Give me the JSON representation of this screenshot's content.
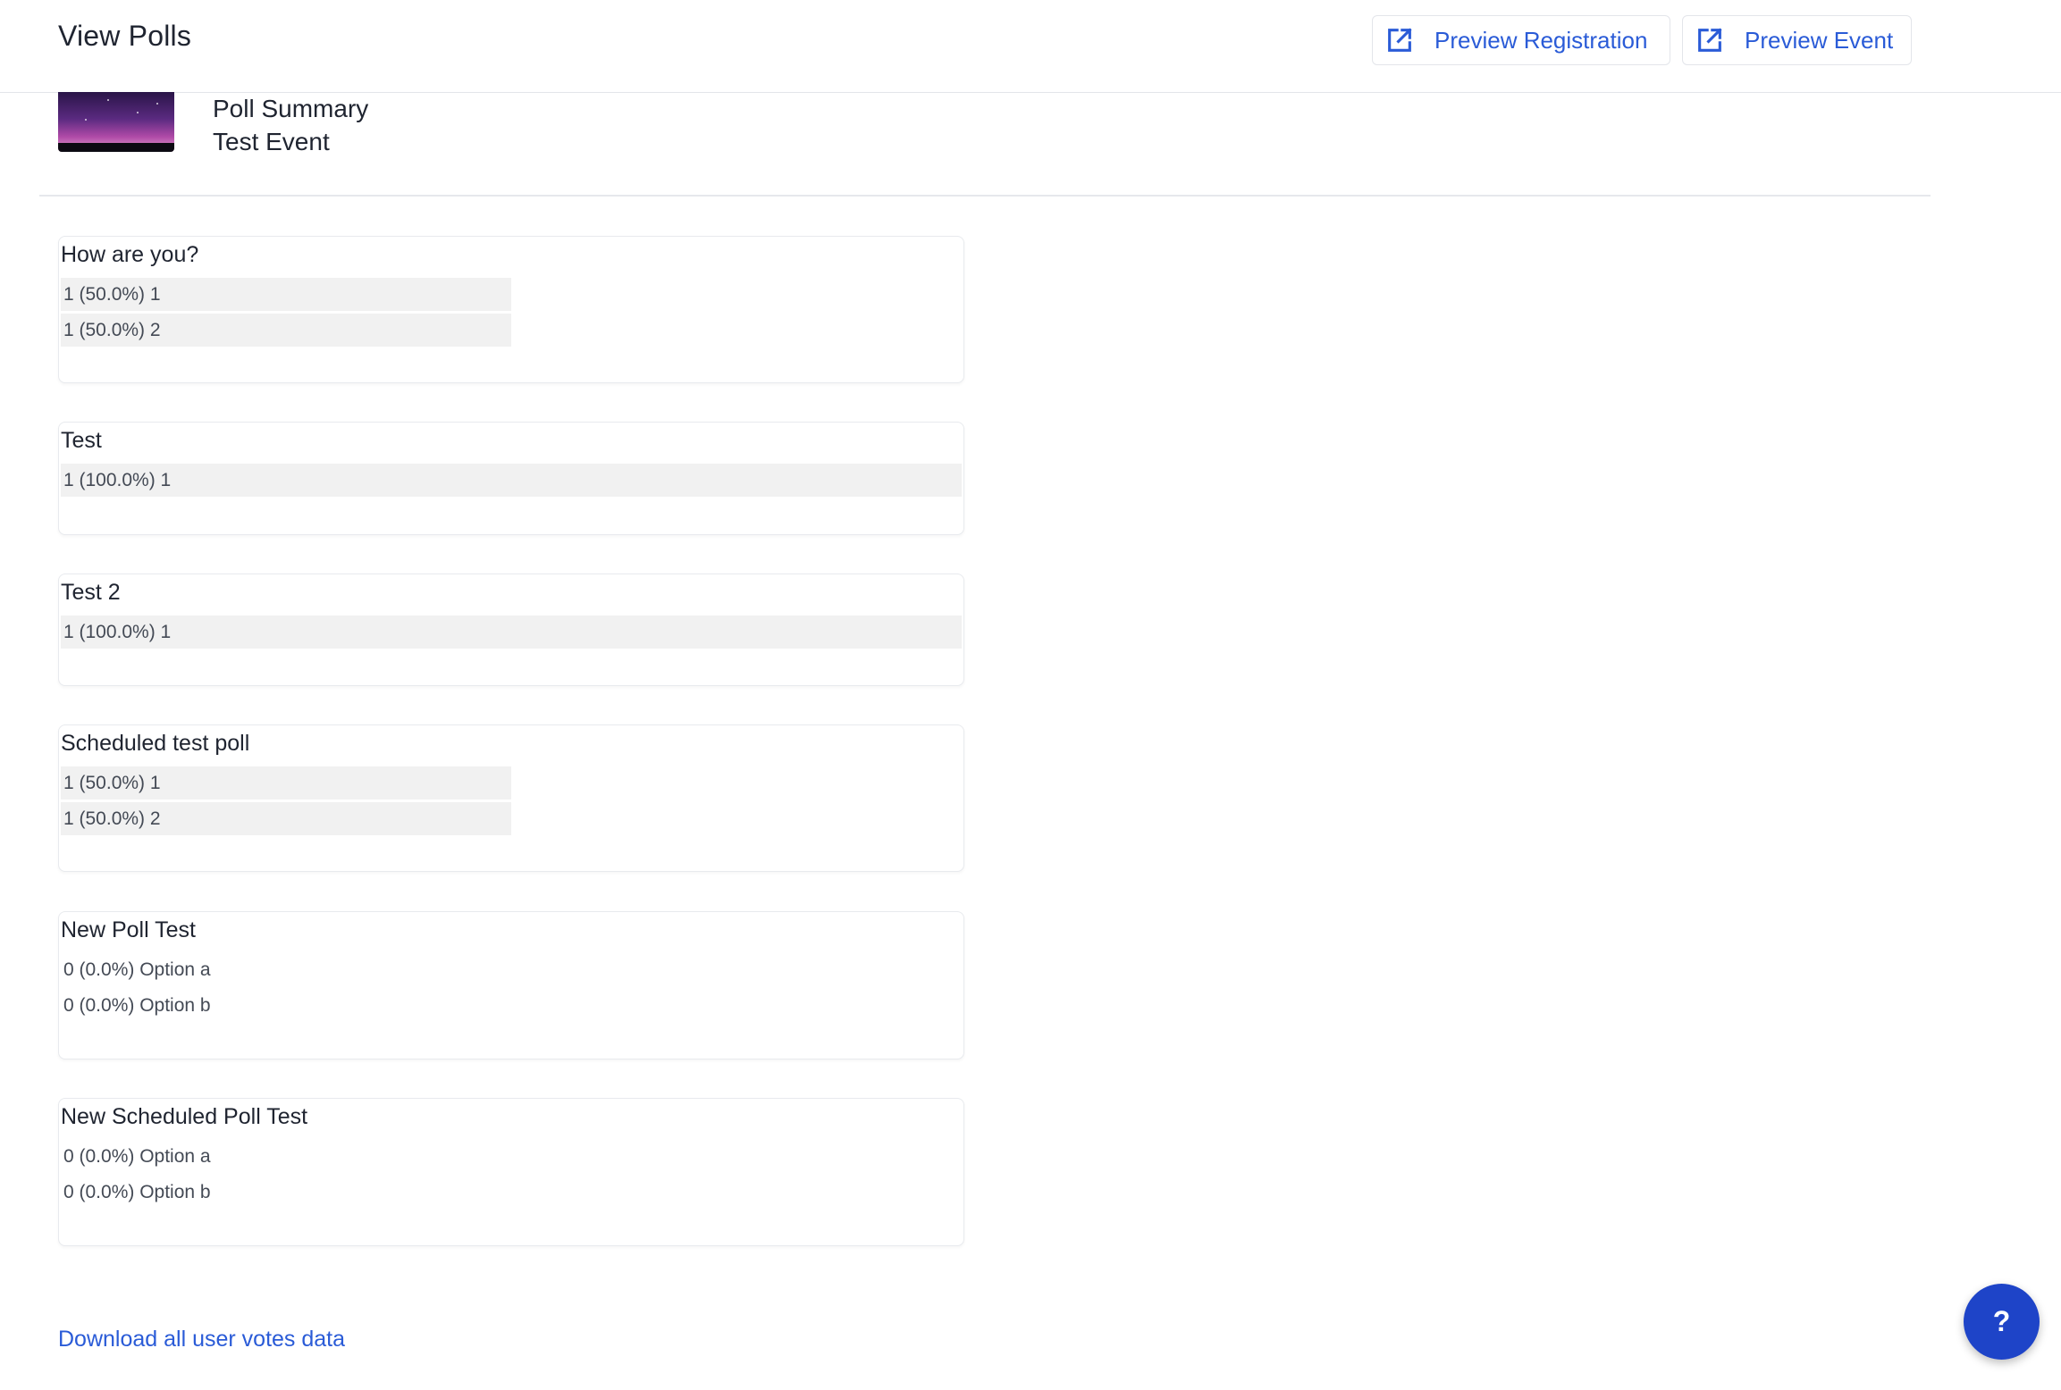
{
  "header": {
    "title": "View Polls",
    "preview_registration": "Preview Registration",
    "preview_event": "Preview Event"
  },
  "summary": {
    "title": "Poll Summary",
    "event_name": "Test Event"
  },
  "polls": [
    {
      "question": "How are you?",
      "options": [
        {
          "label": "1 (50.0%) 1",
          "fraction": 0.5
        },
        {
          "label": "1 (50.0%) 2",
          "fraction": 0.5
        }
      ]
    },
    {
      "question": "Test",
      "options": [
        {
          "label": "1 (100.0%) 1",
          "fraction": 1.0
        }
      ]
    },
    {
      "question": "Test 2",
      "options": [
        {
          "label": "1 (100.0%) 1",
          "fraction": 1.0
        }
      ]
    },
    {
      "question": "Scheduled test poll",
      "options": [
        {
          "label": "1 (50.0%) 1",
          "fraction": 0.5
        },
        {
          "label": "1 (50.0%) 2",
          "fraction": 0.5
        }
      ]
    },
    {
      "question": "New Poll Test",
      "options": [
        {
          "label": "0 (0.0%) Option a",
          "fraction": 0.0
        },
        {
          "label": "0 (0.0%) Option b",
          "fraction": 0.0
        }
      ]
    },
    {
      "question": "New Scheduled Poll Test",
      "options": [
        {
          "label": "0 (0.0%) Option a",
          "fraction": 0.0
        },
        {
          "label": "0 (0.0%) Option b",
          "fraction": 0.0
        }
      ]
    }
  ],
  "footer": {
    "download_label": "Download all user votes data",
    "help_label": "?"
  },
  "colors": {
    "accent": "#2a5bd7",
    "help_button": "#1e44c8",
    "bar": "#f1f1f1"
  },
  "icons": {
    "preview": "external-link-icon",
    "help": "question-mark-icon"
  }
}
